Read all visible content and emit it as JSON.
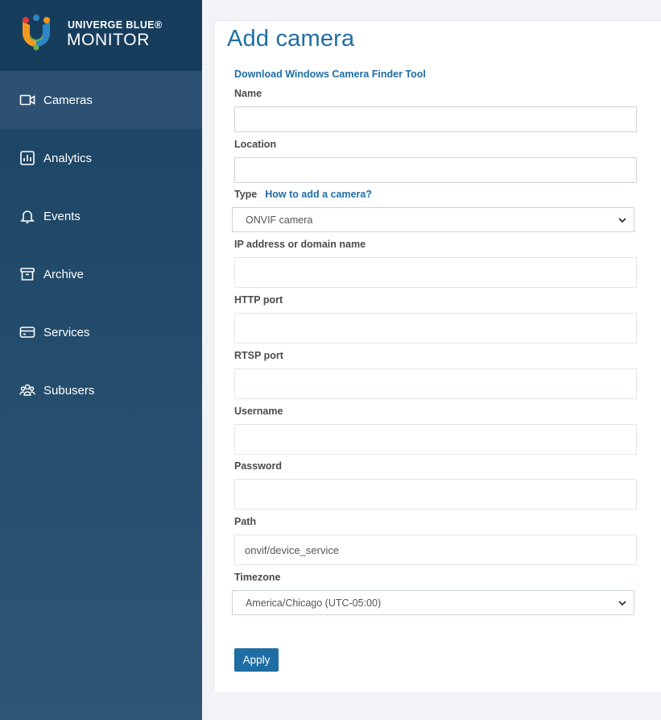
{
  "brand": {
    "line1": "UNIVERGE BLUE®",
    "line2": "MONITOR"
  },
  "nav": {
    "items": [
      {
        "label": "Cameras",
        "icon": "camera-icon",
        "active": true
      },
      {
        "label": "Analytics",
        "icon": "analytics-icon",
        "active": false
      },
      {
        "label": "Events",
        "icon": "bell-icon",
        "active": false
      },
      {
        "label": "Archive",
        "icon": "archive-icon",
        "active": false
      },
      {
        "label": "Services",
        "icon": "card-icon",
        "active": false
      },
      {
        "label": "Subusers",
        "icon": "users-icon",
        "active": false
      }
    ]
  },
  "page": {
    "title": "Add camera"
  },
  "form": {
    "finder_link": "Download Windows Camera Finder Tool",
    "name": {
      "label": "Name",
      "value": ""
    },
    "location": {
      "label": "Location",
      "value": ""
    },
    "type": {
      "label": "Type",
      "help_link": "How to add a camera?",
      "selected": "ONVIF camera"
    },
    "ip": {
      "label": "IP address or domain name",
      "value": ""
    },
    "http_port": {
      "label": "HTTP port",
      "value": ""
    },
    "rtsp_port": {
      "label": "RTSP port",
      "value": ""
    },
    "username": {
      "label": "Username",
      "value": ""
    },
    "password": {
      "label": "Password",
      "value": ""
    },
    "path": {
      "label": "Path",
      "value": "onvif/device_service"
    },
    "timezone": {
      "label": "Timezone",
      "selected": "America/Chicago (UTC-05:00)"
    },
    "apply_label": "Apply"
  },
  "colors": {
    "accent": "#1f6ea3",
    "sidebar": "#1a4263"
  }
}
